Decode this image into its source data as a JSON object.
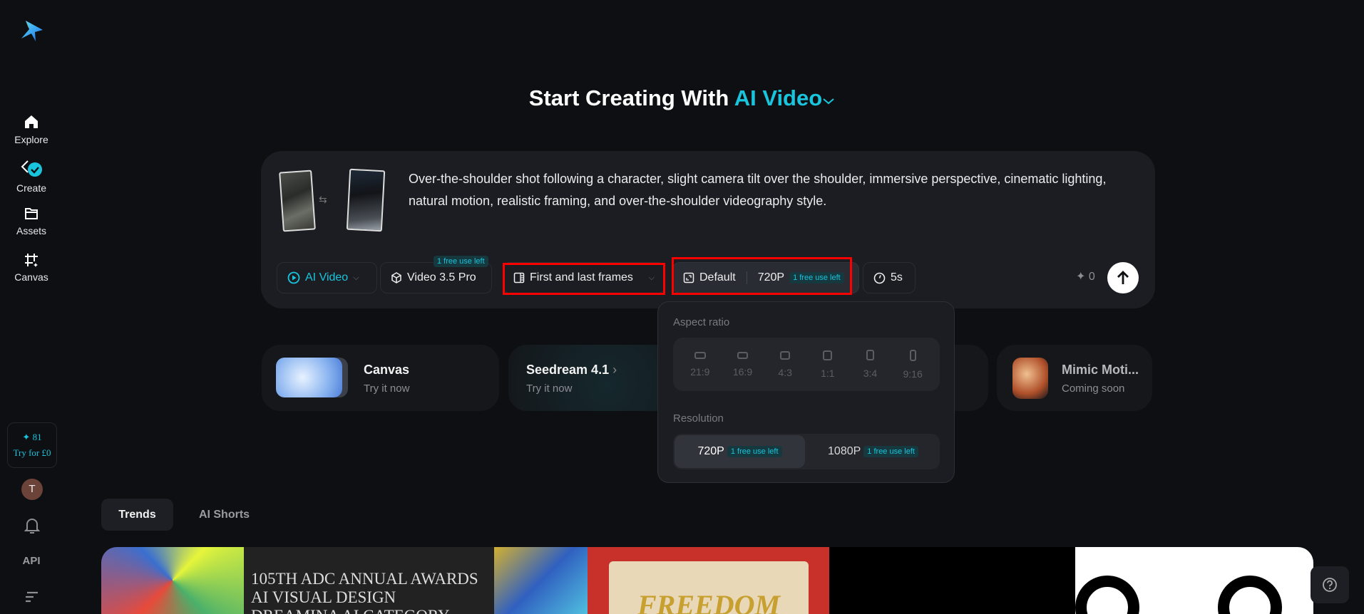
{
  "sidebar": {
    "items": [
      {
        "label": "Explore",
        "icon": "home-icon"
      },
      {
        "label": "Create",
        "icon": "create-icon"
      },
      {
        "label": "Assets",
        "icon": "folder-icon"
      },
      {
        "label": "Canvas",
        "icon": "canvas-icon"
      }
    ],
    "credits": "81",
    "credits_cta": "Try for £0",
    "avatar_initial": "T",
    "api_label": "API"
  },
  "header": {
    "title_prefix": "Start Creating With",
    "title_accent": "AI Video"
  },
  "prompt": {
    "text": "Over-the-shoulder shot following a character, slight camera tilt over the shoulder, immersive perspective, cinematic lighting, natural motion, realistic framing, and over-the-shoulder videography style."
  },
  "toolbar": {
    "mode": "AI Video",
    "model": "Video 3.5 Pro",
    "model_badge": "1 free use left",
    "frames": "First and last frames",
    "aspect": "Default",
    "resolution": "720P",
    "resolution_badge": "1 free use left",
    "duration": "5s",
    "cost": "0"
  },
  "dropdown": {
    "aspect_label": "Aspect ratio",
    "aspect_options": [
      "21:9",
      "16:9",
      "4:3",
      "1:1",
      "3:4",
      "9:16"
    ],
    "resolution_label": "Resolution",
    "resolutions": [
      {
        "label": "720P",
        "badge": "1 free use left"
      },
      {
        "label": "1080P",
        "badge": "1 free use left"
      }
    ]
  },
  "cards": [
    {
      "title": "Canvas",
      "sub": "Try it now"
    },
    {
      "title": "Seedream 4.1",
      "sub": "Try it now"
    },
    {
      "title": "Mimic Moti...",
      "sub": "Coming soon"
    }
  ],
  "tabs": [
    "Trends",
    "AI Shorts"
  ],
  "gallery": {
    "award_text": [
      "105TH ADC ANNUAL AWARDS",
      "AI VISUAL DESIGN",
      "DREAMINA AI CATEGORY"
    ],
    "scroll_text": "FREEDOM"
  },
  "colors": {
    "accent": "#18c5dd",
    "bg": "#0e0f12",
    "panel": "#1c1d22"
  }
}
